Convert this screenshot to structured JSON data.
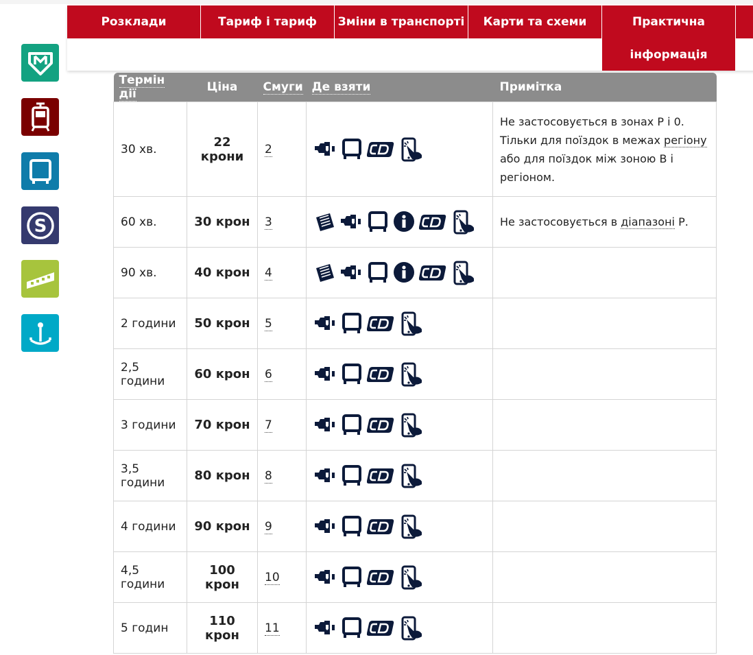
{
  "nav": {
    "items": [
      "Розклади",
      "Тариф і тариф",
      "Зміни в транспорті",
      "Карти та схеми"
    ],
    "practical_line1": "Практична",
    "practical_line2": "інформація"
  },
  "side_icons": [
    {
      "name": "metro-icon",
      "color": "#13a281"
    },
    {
      "name": "tram-icon",
      "color": "#7a0000"
    },
    {
      "name": "bus-icon",
      "color": "#0f7caa"
    },
    {
      "name": "train-icon",
      "color": "#353a6e"
    },
    {
      "name": "funicular-icon",
      "color": "#a7c43d"
    },
    {
      "name": "ferry-icon",
      "color": "#00a9c7"
    }
  ],
  "table": {
    "headers": {
      "validity": "Термін дії",
      "price": "Ціна",
      "rides": "Смуги",
      "where": "Де взяти",
      "note": "Примітка"
    },
    "rows": [
      {
        "validity": "30 хв.",
        "price": "22 крони",
        "rides": "2",
        "icons": [
          "machine",
          "stop",
          "cd",
          "app"
        ],
        "note_a": "Не застосовується в зонах Р і 0. Тільки для поїздок в межах ",
        "note_link": "регіону",
        "note_b": " або для поїздок між зоною В і регіоном."
      },
      {
        "validity": "60 хв.",
        "price": "30 крон",
        "rides": "3",
        "icons": [
          "doc",
          "machine",
          "stop",
          "info",
          "cd",
          "app"
        ],
        "note_a": "Не застосовується в ",
        "note_link": "діапазоні",
        "note_b": " Р."
      },
      {
        "validity": "90 хв.",
        "price": "40 крон",
        "rides": "4",
        "icons": [
          "doc",
          "machine",
          "stop",
          "info",
          "cd",
          "app"
        ]
      },
      {
        "validity": "2 години",
        "price": "50 крон",
        "rides": "5",
        "icons": [
          "machine",
          "stop",
          "cd",
          "app"
        ]
      },
      {
        "validity": "2,5 години",
        "price": "60 крон",
        "rides": "6",
        "icons": [
          "machine",
          "stop",
          "cd",
          "app"
        ]
      },
      {
        "validity": "3 години",
        "price": "70 крон",
        "rides": "7",
        "icons": [
          "machine",
          "stop",
          "cd",
          "app"
        ]
      },
      {
        "validity": "3,5 години",
        "price": "80 крон",
        "rides": "8",
        "icons": [
          "machine",
          "stop",
          "cd",
          "app"
        ]
      },
      {
        "validity": "4 години",
        "price": "90 крон",
        "rides": "9",
        "icons": [
          "machine",
          "stop",
          "cd",
          "app"
        ]
      },
      {
        "validity": "4,5 години",
        "price": "100 крон",
        "rides": "10",
        "icons": [
          "machine",
          "stop",
          "cd",
          "app"
        ]
      },
      {
        "validity": "5 годин",
        "price": "110 крон",
        "rides": "11",
        "icons": [
          "machine",
          "stop",
          "cd",
          "app"
        ]
      }
    ]
  },
  "colors": {
    "nav_red": "#c00a1e",
    "header_gray": "#8c8c8c",
    "icon_navy": "#0c1a3a"
  }
}
